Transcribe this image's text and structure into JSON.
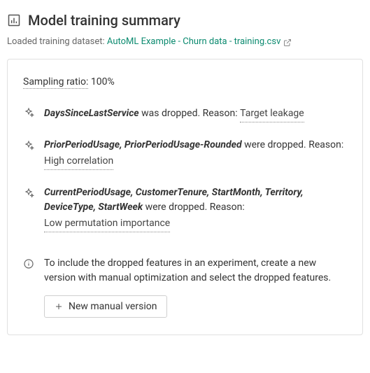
{
  "header": {
    "title": "Model training summary",
    "subtitle_prefix": "Loaded training dataset: ",
    "dataset_link_text": "AutoML Example - Churn data - training.csv"
  },
  "card": {
    "sampling_label": "Sampling ratio:",
    "sampling_value": "100%",
    "drops": [
      {
        "features": "DaysSinceLastService",
        "suffix": " was dropped. Reason: ",
        "reason": "Target leakage",
        "reason_inline": true
      },
      {
        "features": "PriorPeriodUsage, PriorPeriodUsage-Rounded",
        "suffix": " were dropped. Reason:",
        "reason": "High correlation",
        "reason_inline": false
      },
      {
        "features": "CurrentPeriodUsage, CustomerTenure, StartMonth, Territory, DeviceType, StartWeek",
        "suffix": " were dropped. Reason:",
        "reason": "Low permutation importance",
        "reason_inline": false
      }
    ],
    "info_text": "To include the dropped features in an experiment, create a new version with manual optimization and select the dropped features.",
    "button_label": "New manual version"
  }
}
